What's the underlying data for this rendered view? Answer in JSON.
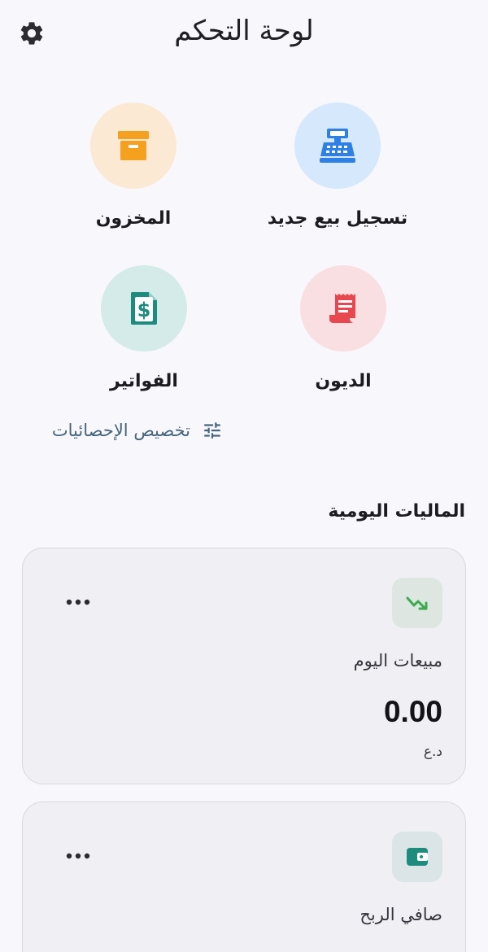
{
  "header": {
    "title": "لوحة التحكم",
    "settings_icon": "gear-icon"
  },
  "actions": {
    "new_sale": {
      "label": "تسجيل بيع جديد",
      "icon": "cash-register-icon",
      "bg": "#d6e8fb",
      "fg": "#2f80e4"
    },
    "inventory": {
      "label": "المخزون",
      "icon": "archive-box-icon",
      "bg": "#fbe9d4",
      "fg": "#f5a01e"
    },
    "debts": {
      "label": "الديون",
      "icon": "receipt-icon",
      "bg": "#f9dfe1",
      "fg": "#e9474f"
    },
    "invoices": {
      "label": "الفواتير",
      "icon": "invoice-dollar-icon",
      "bg": "#d5ebea",
      "fg": "#1d8c7e"
    }
  },
  "customize": {
    "label": "تخصيص الإحصائيات",
    "icon": "sliders-icon"
  },
  "daily_finance": {
    "title": "الماليات اليومية",
    "cards": [
      {
        "label": "مبيعات اليوم",
        "value": "0.00",
        "unit": "د.ع",
        "icon": "trend-down-icon"
      },
      {
        "label": "صافي الربح",
        "icon": "wallet-icon"
      }
    ]
  },
  "colors": {
    "background": "#f8f7fc",
    "card_background": "#f0f0f4",
    "accent_text": "#45657a",
    "trend_green": "#3cab4e",
    "wallet_teal": "#1d8c7e"
  }
}
